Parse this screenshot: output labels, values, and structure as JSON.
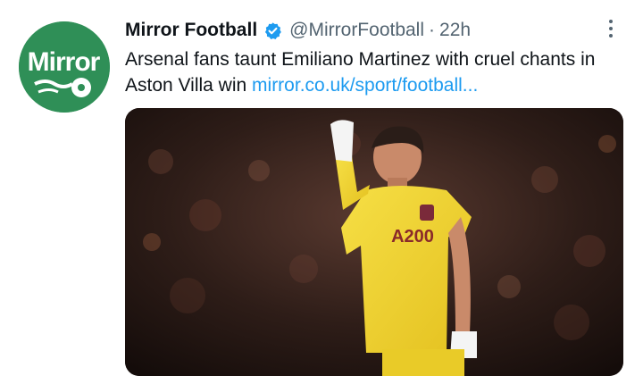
{
  "tweet": {
    "avatar_text": "Mirror",
    "display_name": "Mirror Football",
    "handle": "@MirrorFootball",
    "separator": "·",
    "timestamp": "22h",
    "text": "Arsenal fans taunt Emiliano Martinez with cruel chants in Aston Villa win ",
    "link_text": "mirror.co.uk/sport/football...",
    "media_sponsor_text": "A200"
  },
  "icons": {
    "verified": "verified-badge-icon",
    "more": "more-options-icon"
  },
  "colors": {
    "avatar_bg": "#2f8f57",
    "link": "#1d9bf0",
    "verified": "#1d9bf0",
    "secondary_text": "#536471",
    "jersey": "#f2d531"
  }
}
